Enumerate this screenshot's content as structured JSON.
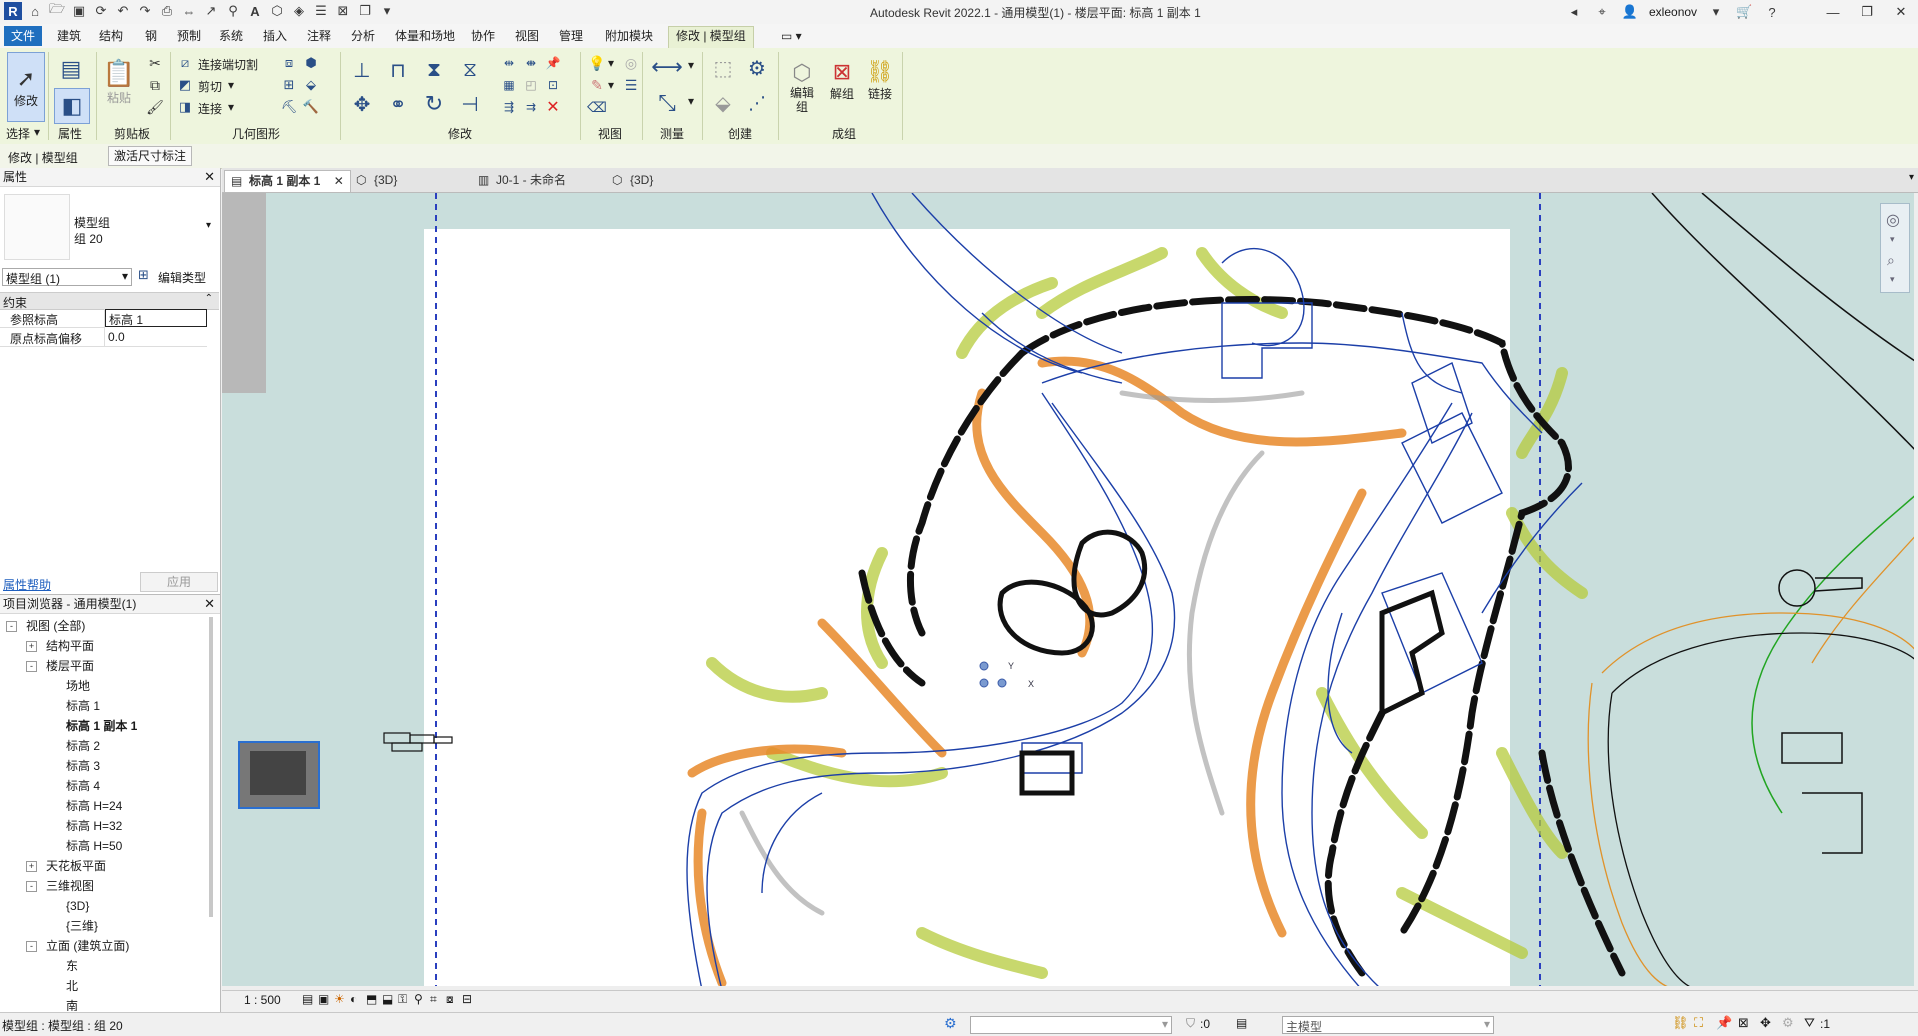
{
  "app": {
    "title": "Autodesk Revit 2022.1 - 通用模型(1) - 楼层平面: 标高 1 副本 1",
    "user": "exleonov",
    "logo": "R"
  },
  "ribbon_tabs": [
    "文件",
    "建筑",
    "结构",
    "钢",
    "预制",
    "系统",
    "插入",
    "注释",
    "分析",
    "体量和场地",
    "协作",
    "视图",
    "管理",
    "附加模块",
    "修改 | 模型组"
  ],
  "ribbon": {
    "modify_label": "修改",
    "paste_label": "粘贴",
    "join_cut_label": "连接端切割",
    "cut_label": "剪切",
    "join_label": "连接",
    "edit_group_label": "编辑组",
    "ungroup_label": "解组",
    "link_label": "链接",
    "panels": {
      "select": "选择",
      "properties": "属性",
      "clipboard": "剪贴板",
      "geometry": "几何图形",
      "modify": "修改",
      "view": "视图",
      "measure": "测量",
      "create": "创建",
      "group": "成组"
    }
  },
  "context": {
    "label": "修改 | 模型组",
    "button": "激活尺寸标注"
  },
  "properties": {
    "title": "属性",
    "type_line1": "模型组",
    "type_line2": "组 20",
    "instance_select": "模型组 (1)",
    "edit_type": "编辑类型",
    "section": "约束",
    "rows": [
      {
        "label": "参照标高",
        "value": "标高 1"
      },
      {
        "label": "原点标高偏移",
        "value": "0.0"
      }
    ],
    "help": "属性帮助",
    "apply": "应用"
  },
  "browser": {
    "title": "项目浏览器 - 通用模型(1)",
    "items": [
      {
        "label": "视图 (全部)",
        "level": 0,
        "toggle": "-"
      },
      {
        "label": "结构平面",
        "level": 1,
        "toggle": "+"
      },
      {
        "label": "楼层平面",
        "level": 1,
        "toggle": "-"
      },
      {
        "label": "场地",
        "level": 2,
        "toggle": ""
      },
      {
        "label": "标高 1",
        "level": 2,
        "toggle": ""
      },
      {
        "label": "标高 1 副本 1",
        "level": 2,
        "toggle": "",
        "bold": true
      },
      {
        "label": "标高 2",
        "level": 2,
        "toggle": ""
      },
      {
        "label": "标高 3",
        "level": 2,
        "toggle": ""
      },
      {
        "label": "标高 4",
        "level": 2,
        "toggle": ""
      },
      {
        "label": "标高 H=24",
        "level": 2,
        "toggle": ""
      },
      {
        "label": "标高 H=32",
        "level": 2,
        "toggle": ""
      },
      {
        "label": "标高 H=50",
        "level": 2,
        "toggle": ""
      },
      {
        "label": "天花板平面",
        "level": 1,
        "toggle": "+"
      },
      {
        "label": "三维视图",
        "level": 1,
        "toggle": "-"
      },
      {
        "label": "{3D}",
        "level": 2,
        "toggle": ""
      },
      {
        "label": "{三维}",
        "level": 2,
        "toggle": ""
      },
      {
        "label": "立面 (建筑立面)",
        "level": 1,
        "toggle": "-"
      },
      {
        "label": "东",
        "level": 2,
        "toggle": ""
      },
      {
        "label": "北",
        "level": 2,
        "toggle": ""
      },
      {
        "label": "南",
        "level": 2,
        "toggle": ""
      }
    ]
  },
  "view_tabs": [
    {
      "label": "标高 1 副本 1",
      "active": true
    },
    {
      "label": "{3D}",
      "active": false
    },
    {
      "label": "J0-1 - 未命名",
      "active": false
    },
    {
      "label": "{3D}",
      "active": false
    }
  ],
  "canvas": {
    "axis_y": "Y",
    "axis_x": "X"
  },
  "view_control": {
    "scale": "1 : 500"
  },
  "status": {
    "text": "模型组 : 模型组 : 组 20",
    "zero": ":0",
    "model": "主模型",
    "filter": ":1"
  },
  "colors": {
    "accent": "#1f6fbf",
    "ribbon_bg": "#eef5dd",
    "canvas_bg": "#c9dedc",
    "sketch_blue": "#1c3fa8",
    "sketch_orange": "#e8892a",
    "sketch_green": "#b4c93a"
  }
}
